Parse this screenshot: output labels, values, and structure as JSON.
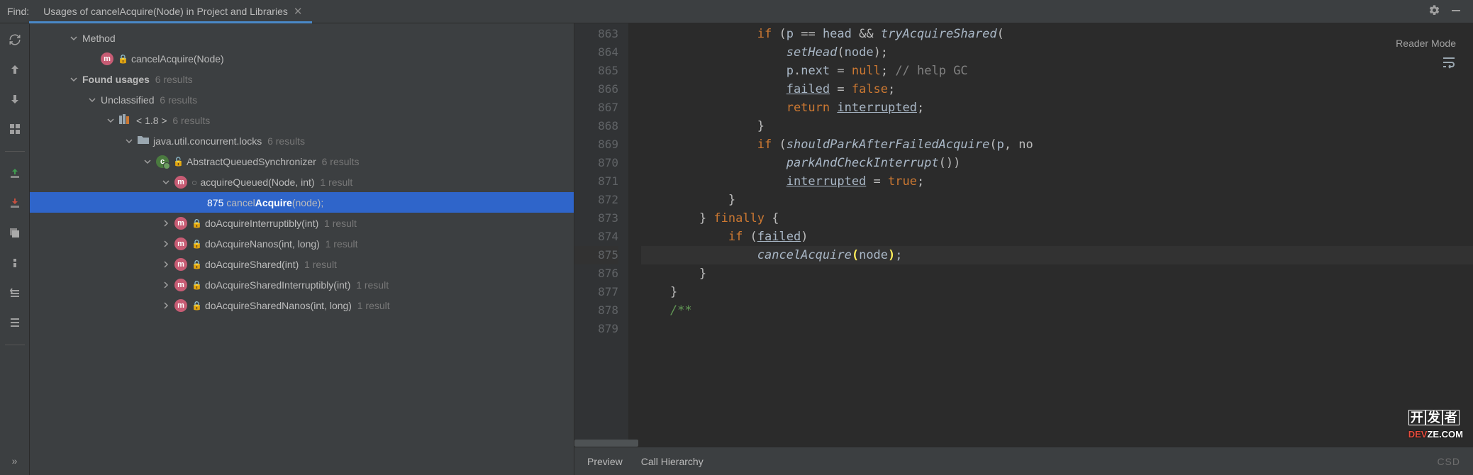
{
  "topbar": {
    "find_label": "Find:",
    "tab_title": "Usages of cancelAcquire(Node) in Project and Libraries"
  },
  "toolbar_icons": [
    "refresh-icon",
    "arrow-up-icon",
    "arrow-down-icon",
    "group-icon",
    "separator",
    "import-icon",
    "export-icon",
    "stack-icon",
    "info-icon",
    "expand-all-icon",
    "collapse-all-icon"
  ],
  "tree": {
    "method_label": "Method",
    "method_sig": "cancelAcquire(Node)",
    "found_usages_label": "Found usages",
    "found_usages_count": "6 results",
    "unclassified_label": "Unclassified",
    "unclassified_count": "6 results",
    "lib_label": "< 1.8 >",
    "lib_count": "6 results",
    "pkg_label": "java.util.concurrent.locks",
    "pkg_count": "6 results",
    "class_label": "AbstractQueuedSynchronizer",
    "class_count": "6 results",
    "methods": [
      {
        "name": "acquireQueued(Node, int)",
        "count": "1 result",
        "expanded": true,
        "usage_line": "875",
        "usage_pre": "cancel",
        "usage_bold": "Acquire",
        "usage_post": "(node);"
      },
      {
        "name": "doAcquireInterruptibly(int)",
        "count": "1 result"
      },
      {
        "name": "doAcquireNanos(int, long)",
        "count": "1 result"
      },
      {
        "name": "doAcquireShared(int)",
        "count": "1 result"
      },
      {
        "name": "doAcquireSharedInterruptibly(int)",
        "count": "1 result"
      },
      {
        "name": "doAcquireSharedNanos(int, long)",
        "count": "1 result"
      }
    ]
  },
  "editor": {
    "reader_mode": "Reader Mode",
    "line_start": 863,
    "line_count": 17,
    "lines": {
      "863": "                if (p == head && tryAcquireShared(",
      "864": "                    setHead(node);",
      "865": "                    p.next = null; // help GC",
      "866": "                    failed = false;",
      "867": "                    return interrupted;",
      "868": "                }",
      "869": "                if (shouldParkAfterFailedAcquire(p, no",
      "870": "                    parkAndCheckInterrupt())",
      "871": "                    interrupted = true;",
      "872": "            }",
      "873": "        } finally {",
      "874": "            if (failed)",
      "875": "                cancelAcquire(node);",
      "876": "        }",
      "877": "    }",
      "878": "",
      "879": "    /**"
    }
  },
  "bottom_tabs": {
    "preview": "Preview",
    "call_hierarchy": "Call Hierarchy",
    "brand": "CSD"
  },
  "watermark_logo": {
    "t1": "开",
    "t2": "发",
    "t3": "者",
    "t4": "DEVZE.COM"
  }
}
